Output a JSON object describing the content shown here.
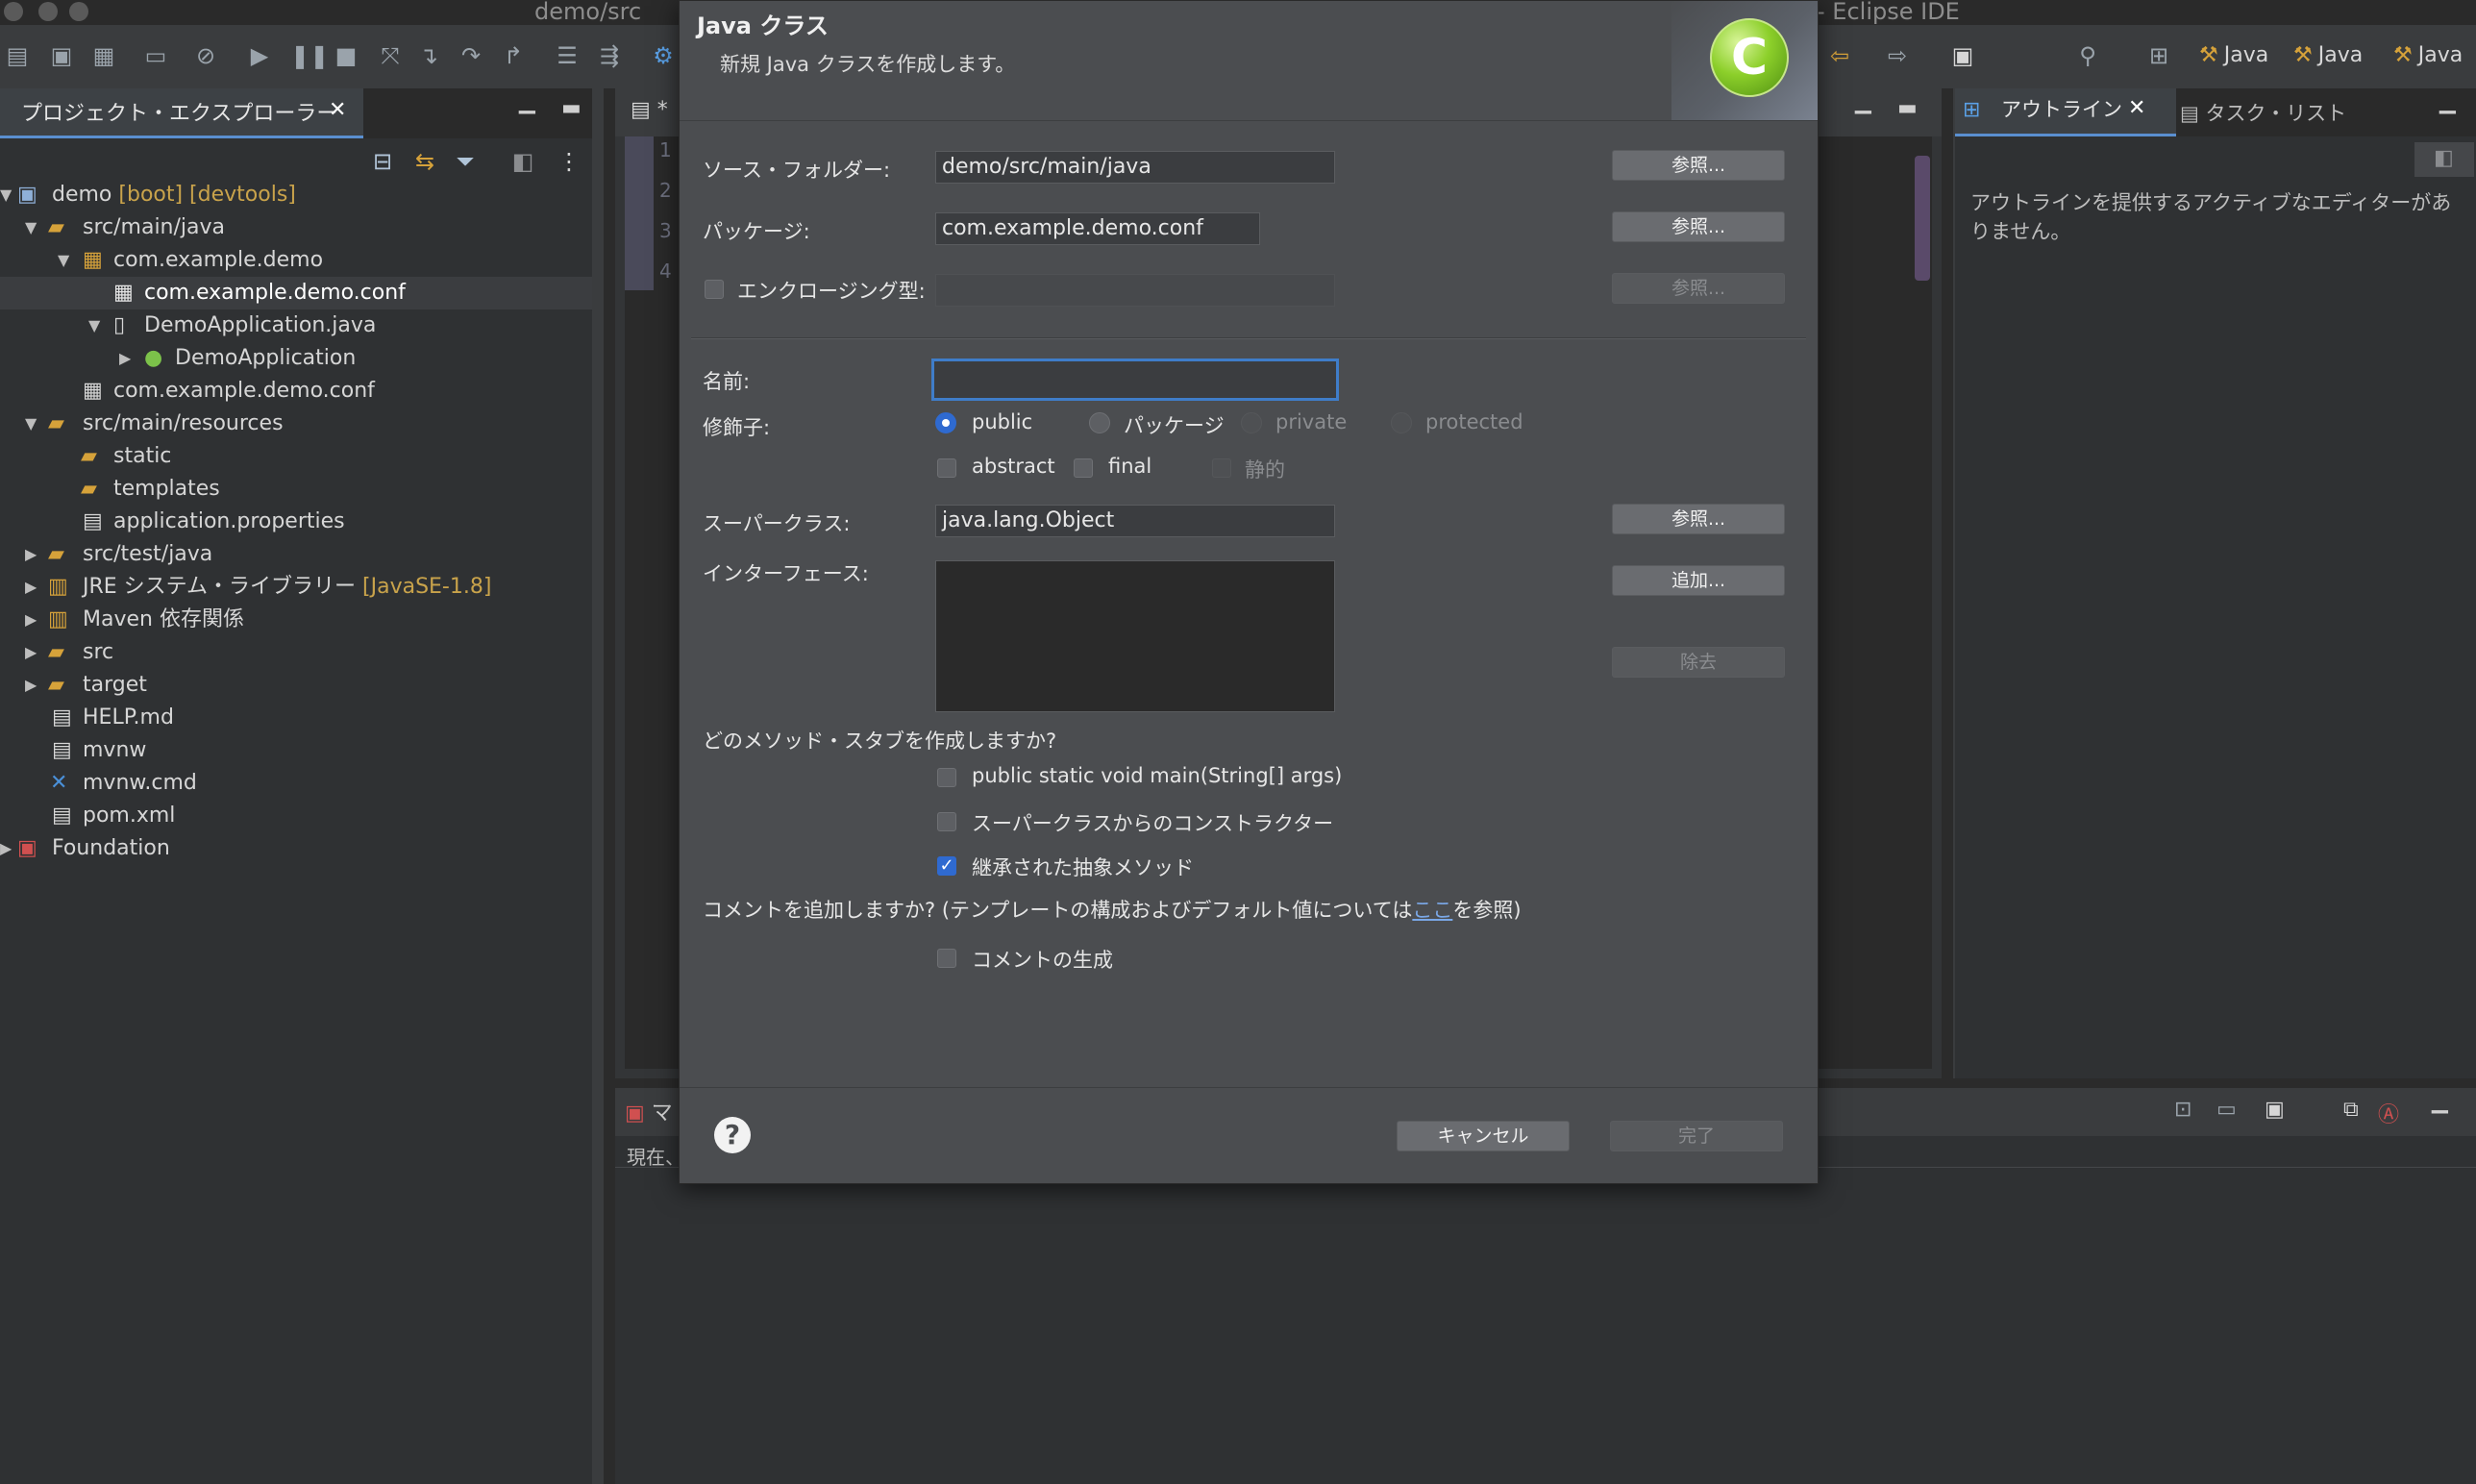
{
  "window": {
    "title_left": "demo/src",
    "title_right": "- Eclipse IDE"
  },
  "perspectives": [
    {
      "label": "Java"
    },
    {
      "label": "Java"
    },
    {
      "label": "Java"
    }
  ],
  "project_explorer": {
    "tab_label": "プロジェクト・エクスプローラー",
    "tree": [
      {
        "label": "demo",
        "decoration": "[boot] [devtools]"
      },
      {
        "label": "src/main/java"
      },
      {
        "label": "com.example.demo"
      },
      {
        "label": "com.example.demo.conf"
      },
      {
        "label": "DemoApplication.java"
      },
      {
        "label": "DemoApplication"
      },
      {
        "label": "com.example.demo.conf"
      },
      {
        "label": "src/main/resources"
      },
      {
        "label": "static"
      },
      {
        "label": "templates"
      },
      {
        "label": "application.properties"
      },
      {
        "label": "src/test/java"
      },
      {
        "label": "JRE システム・ライブラリー",
        "decoration": "[JavaSE-1.8]"
      },
      {
        "label": "Maven 依存関係"
      },
      {
        "label": "src"
      },
      {
        "label": "target"
      },
      {
        "label": "HELP.md"
      },
      {
        "label": "mvnw"
      },
      {
        "label": "mvnw.cmd"
      },
      {
        "label": "pom.xml"
      },
      {
        "label": "Foundation"
      }
    ]
  },
  "editor": {
    "tab_label": "*",
    "line_numbers": [
      "1",
      "2",
      "3",
      "4"
    ]
  },
  "outline": {
    "tab_label": "アウトライン",
    "task_tab_label": "タスク・リスト",
    "empty_text": "アウトラインを提供するアクティブなエディターがありません。"
  },
  "console": {
    "tab_label": "マ",
    "status": "現在、"
  },
  "dialog": {
    "title": "Java クラス",
    "description": "新規 Java クラスを作成します。",
    "source_folder": {
      "label": "ソース・フォルダー:",
      "value": "demo/src/main/java",
      "browse": "参照..."
    },
    "package": {
      "label": "パッケージ:",
      "value": "com.example.demo.conf",
      "browse": "参照..."
    },
    "enclosing": {
      "label": "エンクロージング型:",
      "value": "",
      "browse": "参照..."
    },
    "name": {
      "label": "名前:",
      "value": ""
    },
    "modifiers": {
      "label": "修飾子:",
      "access": [
        {
          "label": "public",
          "selected": true,
          "enabled": true
        },
        {
          "label": "パッケージ",
          "selected": false,
          "enabled": true
        },
        {
          "label": "private",
          "selected": false,
          "enabled": false
        },
        {
          "label": "protected",
          "selected": false,
          "enabled": false
        }
      ],
      "other": [
        {
          "label": "abstract",
          "checked": false,
          "enabled": true
        },
        {
          "label": "final",
          "checked": false,
          "enabled": true
        },
        {
          "label": "静的",
          "checked": false,
          "enabled": false
        }
      ]
    },
    "superclass": {
      "label": "スーパークラス:",
      "value": "java.lang.Object",
      "browse": "参照..."
    },
    "interfaces": {
      "label": "インターフェース:",
      "add": "追加...",
      "remove": "除去"
    },
    "stubs": {
      "question": "どのメソッド・スタブを作成しますか?",
      "options": [
        {
          "label": "public static void main(String[] args)",
          "checked": false
        },
        {
          "label": "スーパークラスからのコンストラクター",
          "checked": false
        },
        {
          "label": "継承された抽象メソッド",
          "checked": true
        }
      ]
    },
    "comments": {
      "question_prefix": "コメントを追加しますか? (テンプレートの構成およびデフォルト値については",
      "link": "ここ",
      "question_suffix": "を参照)",
      "generate_label": "コメントの生成",
      "generate_checked": false
    },
    "footer": {
      "cancel": "キャンセル",
      "finish": "完了"
    }
  }
}
